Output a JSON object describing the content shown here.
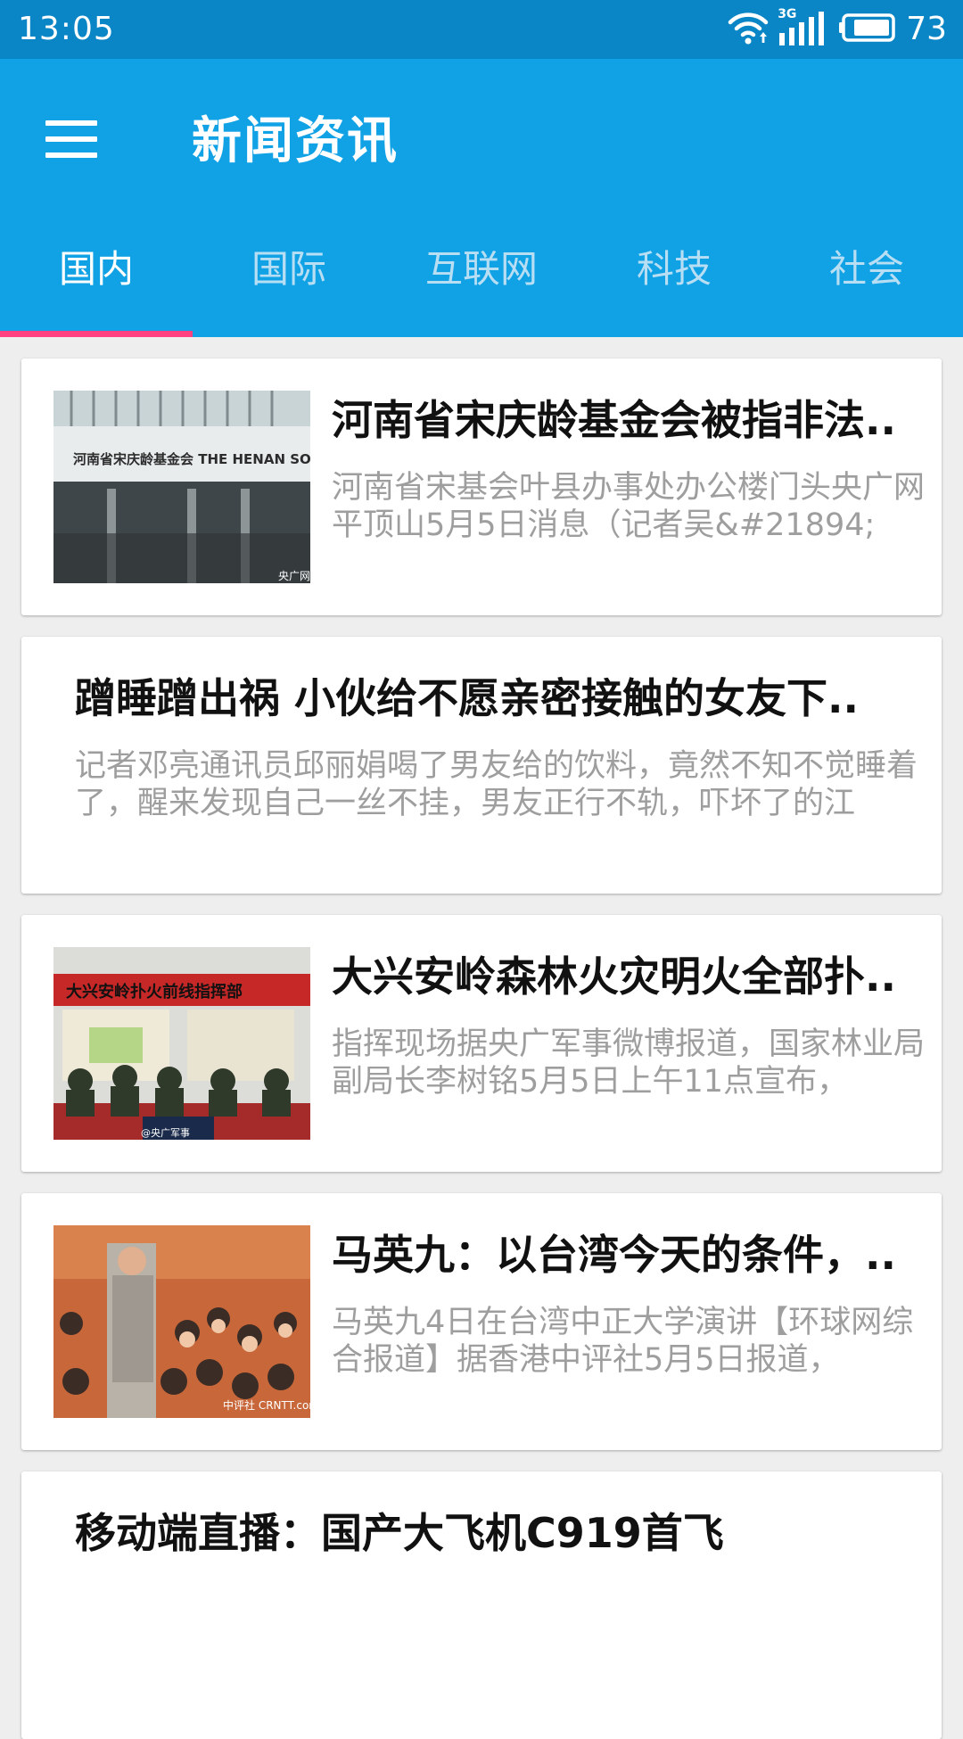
{
  "status_bar": {
    "time": "13:05",
    "network": "3G",
    "battery": "73",
    "icons": [
      "wifi-icon",
      "signal-3g-icon",
      "battery-icon"
    ]
  },
  "app_bar": {
    "title": "新闻资讯",
    "menu_icon": "menu-icon"
  },
  "tabs": [
    {
      "label": "国内",
      "active": true
    },
    {
      "label": "国际",
      "active": false
    },
    {
      "label": "互联网",
      "active": false
    },
    {
      "label": "科技",
      "active": false
    },
    {
      "label": "社会",
      "active": false
    }
  ],
  "colors": {
    "status_bar": "#0a86c7",
    "primary": "#11a2e6",
    "tab_indicator": "#ff4081",
    "background": "#eeeeee"
  },
  "articles": [
    {
      "title": "河南省宋庆龄基金会被指非法..",
      "summary": "河南省宋基会叶县办事处办公楼门头央广网平顶山5月5日消息（记者吴&#21894;",
      "image_text": "河南省宋庆龄基金会 THE HENAN SOONG CHING LING FOUNDATION",
      "image_watermark": "央广网"
    },
    {
      "title": "蹭睡蹭出祸 小伙给不愿亲密接触的女友下..",
      "summary": "记者邓亮通讯员邱丽娟喝了男友给的饮料，竟然不知不觉睡着了，醒来发现自己一丝不挂，男友正行不轨，吓坏了的江"
    },
    {
      "title": "大兴安岭森林火灾明火全部扑..",
      "summary": "指挥现场据央广军事微博报道，国家林业局副局长李树铭5月5日上午11点宣布，",
      "image_text": "大兴安岭扑火前线指挥部",
      "image_watermark": "@央广军事"
    },
    {
      "title": "马英九：以台湾今天的条件，..",
      "summary": "马英九4日在台湾中正大学演讲【环球网综合报道】据香港中评社5月5日报道，",
      "image_watermark": "中评社 CRNTT.com"
    },
    {
      "title": "移动端直播：国产大飞机C919首飞",
      "summary": ""
    }
  ]
}
